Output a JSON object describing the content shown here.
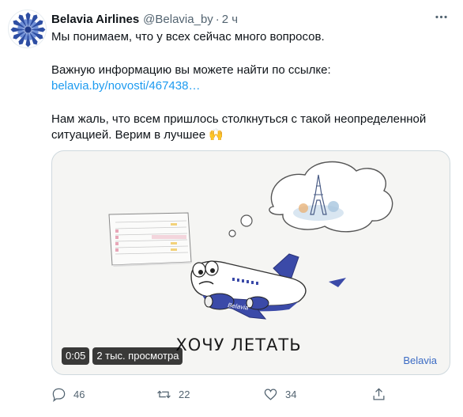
{
  "tweet": {
    "author_name": "Belavia Airlines",
    "author_handle": "@Belavia_by",
    "separator": "·",
    "time": "2 ч",
    "text_line_1": "Мы понимаем, что у всех сейчас много вопросов.",
    "text_line_2": "Важную информацию вы можете найти по ссылке:",
    "link_text": "belavia.by/novosti/467438…",
    "text_line_3": "Нам жаль, что всем пришлось столкнуться с такой неопределенной",
    "text_line_4": "ситуацией. Верим в лучшее",
    "emoji": "🙌"
  },
  "media": {
    "caption": "ХОЧУ ЛЕТАТЬ",
    "brand": "Belavia",
    "plane_text": "Belavia",
    "duration": "0:05",
    "views": "2 тыс. просмотра"
  },
  "actions": {
    "replies": "46",
    "retweets": "22",
    "likes": "34"
  },
  "icons": {
    "reply": "reply-icon",
    "retweet": "retweet-icon",
    "like": "heart-icon",
    "share": "share-icon",
    "more": "more-icon"
  },
  "colors": {
    "link": "#1d9bf0",
    "brand": "#3b4aa8",
    "secondary_text": "#536471"
  }
}
